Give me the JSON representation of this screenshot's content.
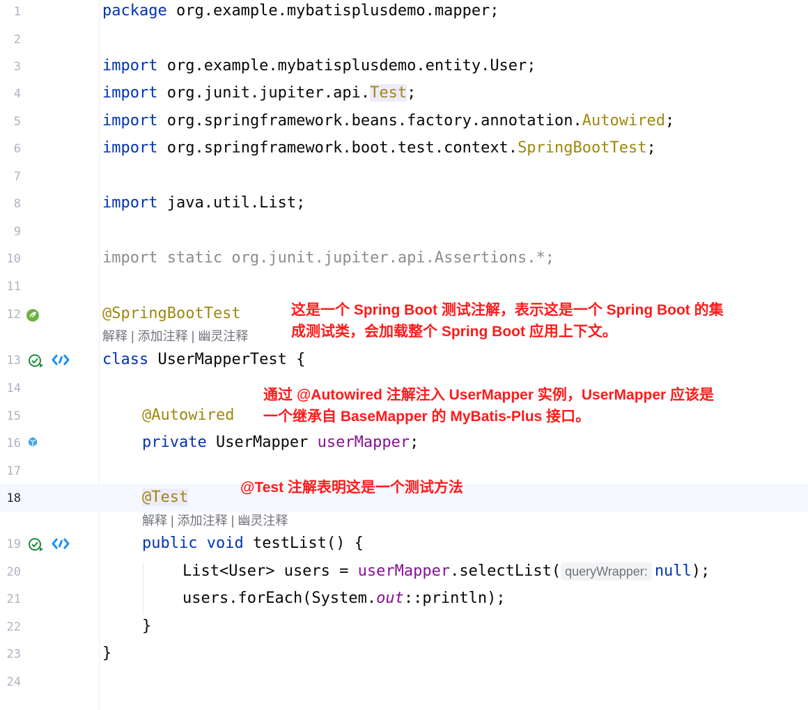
{
  "editor": {
    "line_numbers": [
      "1",
      "2",
      "3",
      "4",
      "5",
      "6",
      "7",
      "8",
      "9",
      "10",
      "11",
      "12",
      "13",
      "14",
      "15",
      "16",
      "17",
      "18",
      "19",
      "20",
      "21",
      "22",
      "23",
      "24"
    ],
    "code": {
      "l1": [
        "package",
        "org.example.mybatisplusdemo.mapper;"
      ],
      "l3": [
        "import",
        "org.example.mybatisplusdemo.entity.User;"
      ],
      "l4": [
        "import",
        "org.junit.jupiter.api.",
        "Test",
        ";"
      ],
      "l5": [
        "import",
        "org.springframework.beans.factory.annotation.",
        "Autowired",
        ";"
      ],
      "l6": [
        "import",
        "org.springframework.boot.test.context.",
        "SpringBootTest",
        ";"
      ],
      "l8": [
        "import",
        "java.util.List;"
      ],
      "l10": [
        "import static org.junit.jupiter.api.Assertions.*;"
      ],
      "l12": [
        "@SpringBootTest"
      ],
      "l13": [
        "class",
        "UserMapperTest {"
      ],
      "l15": [
        "@Autowired"
      ],
      "l16": [
        "private",
        "UserMapper",
        "userMapper",
        ";"
      ],
      "l18": [
        "@Test"
      ],
      "l19": [
        "public void",
        "testList() {"
      ],
      "l20": [
        "List<User> users = ",
        "userMapper",
        ".selectList(",
        "queryWrapper:",
        "null",
        ");"
      ],
      "l21": [
        "users.forEach(System.",
        "out",
        "::println);"
      ],
      "l22": [
        "}"
      ],
      "l23": [
        "}"
      ]
    },
    "inlay_hints": {
      "after_line_12": "解释 | 添加注释 | 幽灵注释",
      "after_line_18": "解释 | 添加注释 | 幽灵注释"
    },
    "gutter_icons": {
      "line_12": "spring-bean-icon",
      "line_13": [
        "run-check-icon",
        "navigate-code-icon"
      ],
      "line_16": "injected-bean-icon",
      "line_19": [
        "run-check-icon",
        "navigate-code-icon"
      ]
    },
    "current_line": 18
  },
  "annotations": {
    "note1_line1": "这是一个 Spring Boot 测试注解，表示这是一个 Spring Boot 的集",
    "note1_line2": "成测试类，会加载整个 Spring Boot 应用上下文。",
    "note2_line1": "通过 @Autowired 注解注入 UserMapper 实例，UserMapper 应该是",
    "note2_line2": "一个继承自 BaseMapper 的 MyBatis-Plus 接口。",
    "note3": "@Test 注解表明这是一个测试方法"
  },
  "colors": {
    "keyword": "#0033b3",
    "annotation": "#9e880d",
    "field": "#871094",
    "note_red": "#ff1a1a",
    "line_number": "#aeb3c2"
  }
}
